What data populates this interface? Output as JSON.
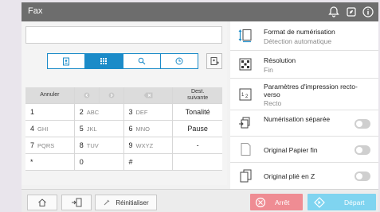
{
  "title_bar": {
    "title": "Fax"
  },
  "keypad": {
    "top_row": [
      "Annuler",
      "",
      "",
      "",
      "Dest.\nsuivante"
    ],
    "rows": [
      [
        {
          "main": "1",
          "sub": ""
        },
        {
          "main": "2",
          "sub": "ABC"
        },
        {
          "main": "3",
          "sub": "DEF"
        },
        {
          "main": "Tonalité",
          "sub": ""
        }
      ],
      [
        {
          "main": "4",
          "sub": "GHI"
        },
        {
          "main": "5",
          "sub": "JKL"
        },
        {
          "main": "6",
          "sub": "MNO"
        },
        {
          "main": "Pause",
          "sub": ""
        }
      ],
      [
        {
          "main": "7",
          "sub": "PQRS"
        },
        {
          "main": "8",
          "sub": "TUV"
        },
        {
          "main": "9",
          "sub": "WXYZ"
        },
        {
          "main": "-",
          "sub": ""
        }
      ],
      [
        {
          "main": "*",
          "sub": ""
        },
        {
          "main": "0",
          "sub": ""
        },
        {
          "main": "#",
          "sub": ""
        },
        {
          "main": "",
          "sub": ""
        }
      ]
    ]
  },
  "settings": {
    "scan_format": {
      "label": "Format de numérisation",
      "value": "Détection automatique"
    },
    "resolution": {
      "label": "Résolution",
      "value": "Fin"
    },
    "print_params": {
      "label": "Paramètres d'impression recto-verso",
      "value": "Recto"
    },
    "separate_scan": {
      "label": "Numérisation séparée",
      "enabled": false
    },
    "thin_paper": {
      "label": "Original Papier fin",
      "enabled": false
    },
    "z_folded": {
      "label": "Original plié en Z",
      "enabled": false
    }
  },
  "bottom_bar": {
    "reset_label": "Réinitialiser",
    "stop_label": "Arrêt",
    "start_label": "Départ"
  },
  "colors": {
    "accent": "#1b8bc8",
    "stop": "#ef8c93",
    "start": "#7fd4f0",
    "title_bar": "#6d6d6d"
  }
}
